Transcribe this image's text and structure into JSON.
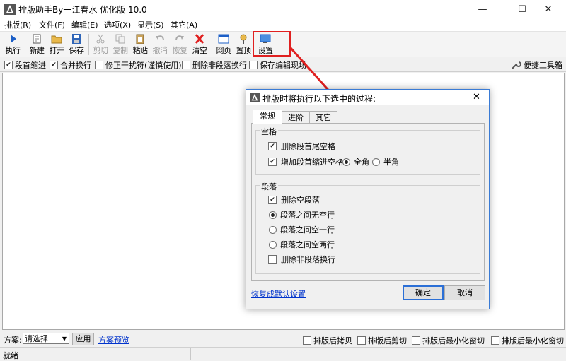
{
  "window": {
    "title": "排版助手By一江春水 优化版 10.0",
    "minimize": "—",
    "maximize": "☐",
    "close": "✕"
  },
  "menu": [
    "排版(R)",
    "文件(F)",
    "编辑(E)",
    "选项(X)",
    "显示(S)",
    "其它(A)"
  ],
  "toolbar": {
    "run": "执行",
    "new": "新建",
    "open": "打开",
    "save": "保存",
    "cut": "剪切",
    "copy": "复制",
    "paste": "粘贴",
    "undo": "撤消",
    "redo": "恢复",
    "clear": "清空",
    "webpage": "网页",
    "pin": "置顶",
    "settings": "设置"
  },
  "options": {
    "indent": "段首缩进",
    "merge": "合并换行",
    "fix": "修正干扰符(谨慎使用)",
    "delete_nonpara": "删除非段落换行",
    "save_scene": "保存编辑现场",
    "toolbox": "便捷工具箱",
    "indent_checked": "✔",
    "merge_checked": "✔"
  },
  "bottom": {
    "scheme_label": "方案:",
    "scheme_value": "请选择",
    "apply": "应用",
    "preview": "方案预览",
    "copy_after": "排版后拷贝",
    "cut_after": "排版后剪切",
    "min_ie": "排版后最小化窗切",
    "min_ie2": "排版后最小化窗切"
  },
  "status": {
    "text": "就绪"
  },
  "dialog": {
    "title": "排版时将执行以下选中的过程:",
    "close": "✕",
    "tabs": [
      "常规",
      "进阶",
      "其它"
    ],
    "group_space": "空格",
    "del_trailing": "删除段首尾空格",
    "add_indent": "增加段首缩进空格",
    "fullwidth": "全角",
    "halfwidth": "半角",
    "group_para": "段落",
    "del_empty": "删除空段落",
    "no_blank": "段落之间无空行",
    "one_blank": "段落之间空一行",
    "two_blank": "段落之间空两行",
    "del_nonpara": "删除非段落换行",
    "restore": "恢复成默认设置",
    "ok": "确定",
    "cancel": "取消",
    "check": "✔"
  },
  "colors": {
    "accent": "#1c5fc7",
    "highlight": "#e02020",
    "link": "#0033cc"
  }
}
